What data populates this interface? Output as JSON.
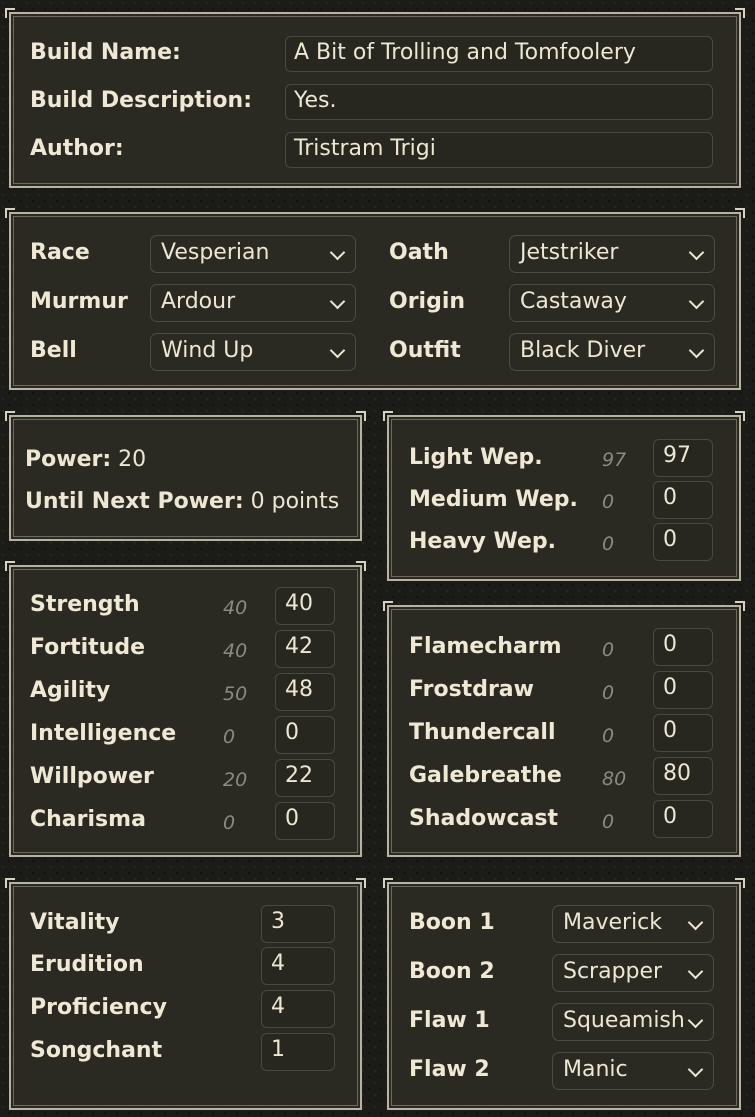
{
  "build": {
    "name_label": "Build Name:",
    "name_value": "A Bit of Trolling and Tomfoolery",
    "description_label": "Build Description:",
    "description_value": "Yes.",
    "author_label": "Author:",
    "author_value": "Tristram Trigi"
  },
  "character": {
    "race_label": "Race",
    "race_value": "Vesperian",
    "murmur_label": "Murmur",
    "murmur_value": "Ardour",
    "bell_label": "Bell",
    "bell_value": "Wind Up",
    "oath_label": "Oath",
    "oath_value": "Jetstriker",
    "origin_label": "Origin",
    "origin_value": "Castaway",
    "outfit_label": "Outfit",
    "outfit_value": "Black Diver"
  },
  "power": {
    "power_label": "Power:",
    "power_value": "20",
    "next_label": "Until Next Power:",
    "next_value": "0 points"
  },
  "weapons": [
    {
      "label": "Light Wep.",
      "base": "97",
      "value": "97"
    },
    {
      "label": "Medium Wep.",
      "base": "0",
      "value": "0"
    },
    {
      "label": "Heavy Wep.",
      "base": "0",
      "value": "0"
    }
  ],
  "attributes": [
    {
      "label": "Strength",
      "base": "40",
      "value": "40"
    },
    {
      "label": "Fortitude",
      "base": "40",
      "value": "42"
    },
    {
      "label": "Agility",
      "base": "50",
      "value": "48"
    },
    {
      "label": "Intelligence",
      "base": "0",
      "value": "0"
    },
    {
      "label": "Willpower",
      "base": "20",
      "value": "22"
    },
    {
      "label": "Charisma",
      "base": "0",
      "value": "0"
    }
  ],
  "attunements": [
    {
      "label": "Flamecharm",
      "base": "0",
      "value": "0"
    },
    {
      "label": "Frostdraw",
      "base": "0",
      "value": "0"
    },
    {
      "label": "Thundercall",
      "base": "0",
      "value": "0"
    },
    {
      "label": "Galebreathe",
      "base": "80",
      "value": "80"
    },
    {
      "label": "Shadowcast",
      "base": "0",
      "value": "0"
    }
  ],
  "investments": [
    {
      "label": "Vitality",
      "value": "3"
    },
    {
      "label": "Erudition",
      "value": "4"
    },
    {
      "label": "Proficiency",
      "value": "4"
    },
    {
      "label": "Songchant",
      "value": "1"
    }
  ],
  "traits": [
    {
      "label": "Boon 1",
      "value": "Maverick"
    },
    {
      "label": "Boon 2",
      "value": "Scrapper"
    },
    {
      "label": "Flaw 1",
      "value": "Squeamish"
    },
    {
      "label": "Flaw 2",
      "value": "Manic"
    }
  ]
}
